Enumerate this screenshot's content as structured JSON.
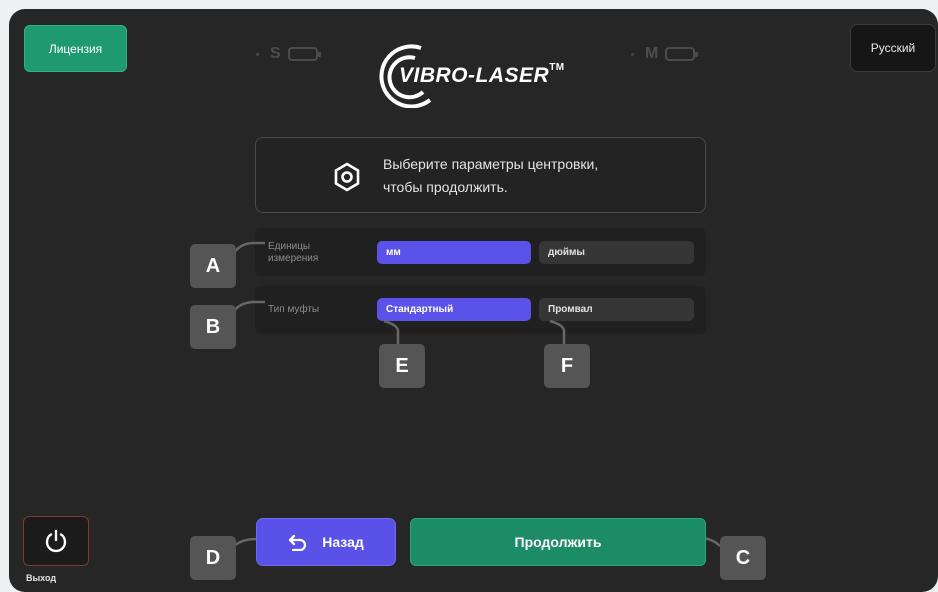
{
  "header": {
    "license_label": "Лицензия",
    "language_label": "Русский",
    "sensor_s_label": "S",
    "sensor_m_label": "M",
    "logo_text": "VIBRO-LASER",
    "logo_tm": "TM"
  },
  "info": {
    "line1": "Выберите параметры центровки,",
    "line2": "чтобы продолжить."
  },
  "settings": {
    "units": {
      "label_line1": "Единицы",
      "label_line2": "измерения",
      "options": [
        "мм",
        "дюймы"
      ],
      "selected": "мм"
    },
    "coupling": {
      "label": "Тип муфты",
      "options": [
        "Стандартный",
        "Промвал"
      ],
      "selected": "Стандартный"
    }
  },
  "callouts": {
    "a": "A",
    "b": "B",
    "c": "C",
    "d": "D",
    "e": "E",
    "f": "F"
  },
  "footer": {
    "exit_label": "Выход",
    "back_label": "Назад",
    "continue_label": "Продолжить"
  },
  "colors": {
    "background": "#262626",
    "accent_green": "#1f9a70",
    "accent_purple": "#5b52ea",
    "callout_grey": "#555555"
  },
  "icons": {
    "info": "hex-nut-icon",
    "exit": "power-icon",
    "back": "undo-arrow-icon"
  }
}
